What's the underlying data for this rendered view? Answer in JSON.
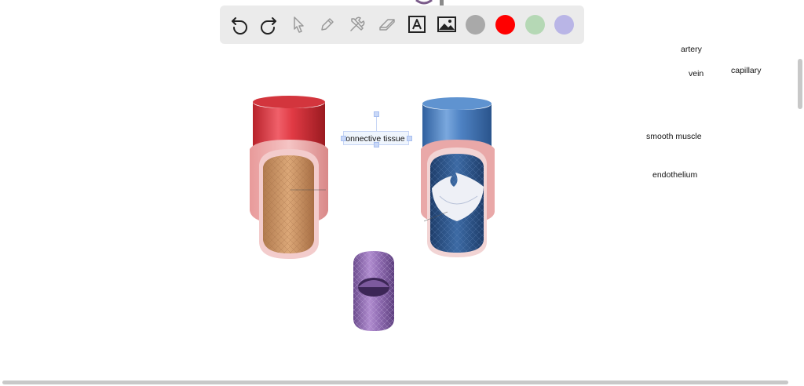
{
  "toolbar": {
    "tools": [
      {
        "name": "undo",
        "icon": "undo-icon"
      },
      {
        "name": "redo",
        "icon": "redo-icon"
      },
      {
        "name": "select",
        "icon": "cursor-icon"
      },
      {
        "name": "pen",
        "icon": "pen-icon"
      },
      {
        "name": "tools",
        "icon": "tools-icon"
      },
      {
        "name": "eraser",
        "icon": "eraser-icon"
      },
      {
        "name": "text",
        "icon": "text-box-icon"
      },
      {
        "name": "image",
        "icon": "image-icon"
      }
    ],
    "colors": [
      "#a9a9a9",
      "#ff0000",
      "#b5d8b5",
      "#b9b5e6"
    ]
  },
  "labels": {
    "artery": "artery",
    "vein": "vein",
    "capillary": "capillary",
    "smooth_muscle": "smooth muscle",
    "endothelium": "endothelium"
  },
  "editing_text": "connective tissue"
}
